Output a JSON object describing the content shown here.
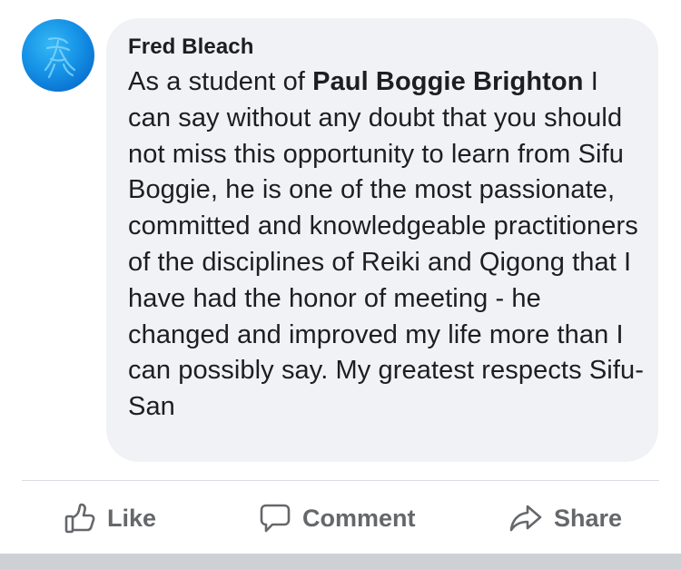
{
  "comment": {
    "author": "Fred Bleach",
    "text_before_mention": "As a student of ",
    "mention": "Paul Boggie Brighton",
    "text_after_mention": " I can say without any doubt that you should not miss this opportunity to learn from Sifu Boggie, he is one of the most passionate, committed and knowledgeable practitioners of the disciplines of Reiki and Qigong that I have had the honor of meeting - he changed and improved my life more than I can possibly say. My greatest respects Sifu-San"
  },
  "actions": {
    "like_label": "Like",
    "comment_label": "Comment",
    "share_label": "Share"
  },
  "icons": {
    "like": "thumbs-up-icon",
    "comment": "speech-bubble-icon",
    "share": "share-arrow-icon"
  },
  "colors": {
    "bubble_bg": "#f0f2f5",
    "text": "#1c1e21",
    "action_text": "#65676b",
    "avatar_blue": "#1592e6"
  }
}
